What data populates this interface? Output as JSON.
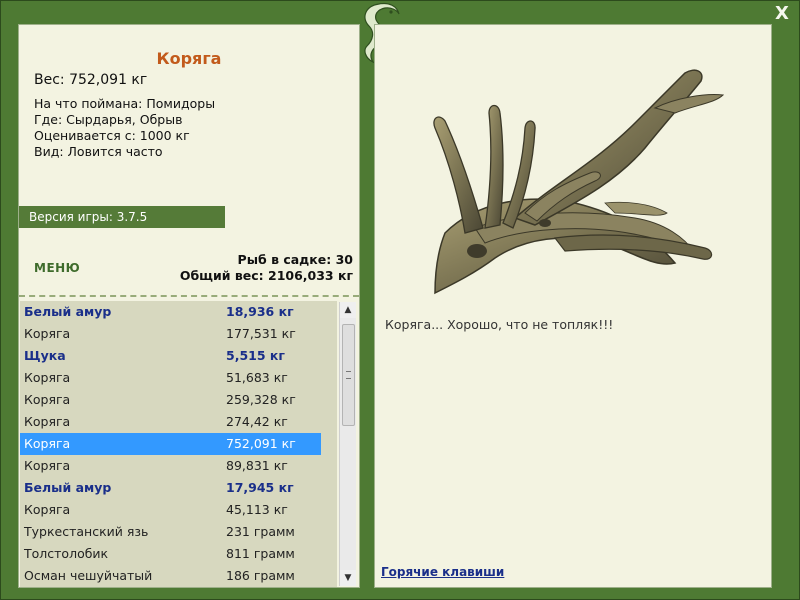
{
  "window": {
    "close_label": "X"
  },
  "catch": {
    "title": "Коряга",
    "weight": "Вес: 752,091 кг",
    "bait": "На что поймана: Помидоры",
    "where": "Где: Сырдарья, Обрыв",
    "value": "Оценивается с: 1000 кг",
    "frequency": "Вид: Ловится часто"
  },
  "version": "Версия игры: 3.7.5",
  "menu_label": "МЕНЮ",
  "stats": {
    "fish_count": "Рыб в садке: 30",
    "total_weight": "Общий вес: 2106,033 кг"
  },
  "catch_list": [
    {
      "name": "Белый амур",
      "weight": "18,936 кг",
      "bold": true,
      "selected": false
    },
    {
      "name": "Коряга",
      "weight": "177,531 кг",
      "bold": false,
      "selected": false
    },
    {
      "name": "Щука",
      "weight": "5,515 кг",
      "bold": true,
      "selected": false
    },
    {
      "name": "Коряга",
      "weight": "51,683 кг",
      "bold": false,
      "selected": false
    },
    {
      "name": "Коряга",
      "weight": "259,328 кг",
      "bold": false,
      "selected": false
    },
    {
      "name": "Коряга",
      "weight": "274,42 кг",
      "bold": false,
      "selected": false
    },
    {
      "name": "Коряга",
      "weight": "752,091 кг",
      "bold": false,
      "selected": true
    },
    {
      "name": "Коряга",
      "weight": "89,831 кг",
      "bold": false,
      "selected": false
    },
    {
      "name": "Белый амур",
      "weight": "17,945 кг",
      "bold": true,
      "selected": false
    },
    {
      "name": "Коряга",
      "weight": "45,113 кг",
      "bold": false,
      "selected": false
    },
    {
      "name": "Туркестанский язь",
      "weight": "231 грамм",
      "bold": false,
      "selected": false
    },
    {
      "name": "Толстолобик",
      "weight": "811 грамм",
      "bold": false,
      "selected": false
    },
    {
      "name": "Осман чешуйчатый",
      "weight": "186 грамм",
      "bold": false,
      "selected": false
    }
  ],
  "description": "Коряга... Хорошо, что не топляк!!!",
  "hotkeys_label": "Горячие клавиши",
  "colors": {
    "frame": "#4e7a33",
    "panel": "#f3f3e1",
    "title": "#c25a1b",
    "selection": "#3399ff",
    "bold_fish": "#1a2f8a"
  }
}
